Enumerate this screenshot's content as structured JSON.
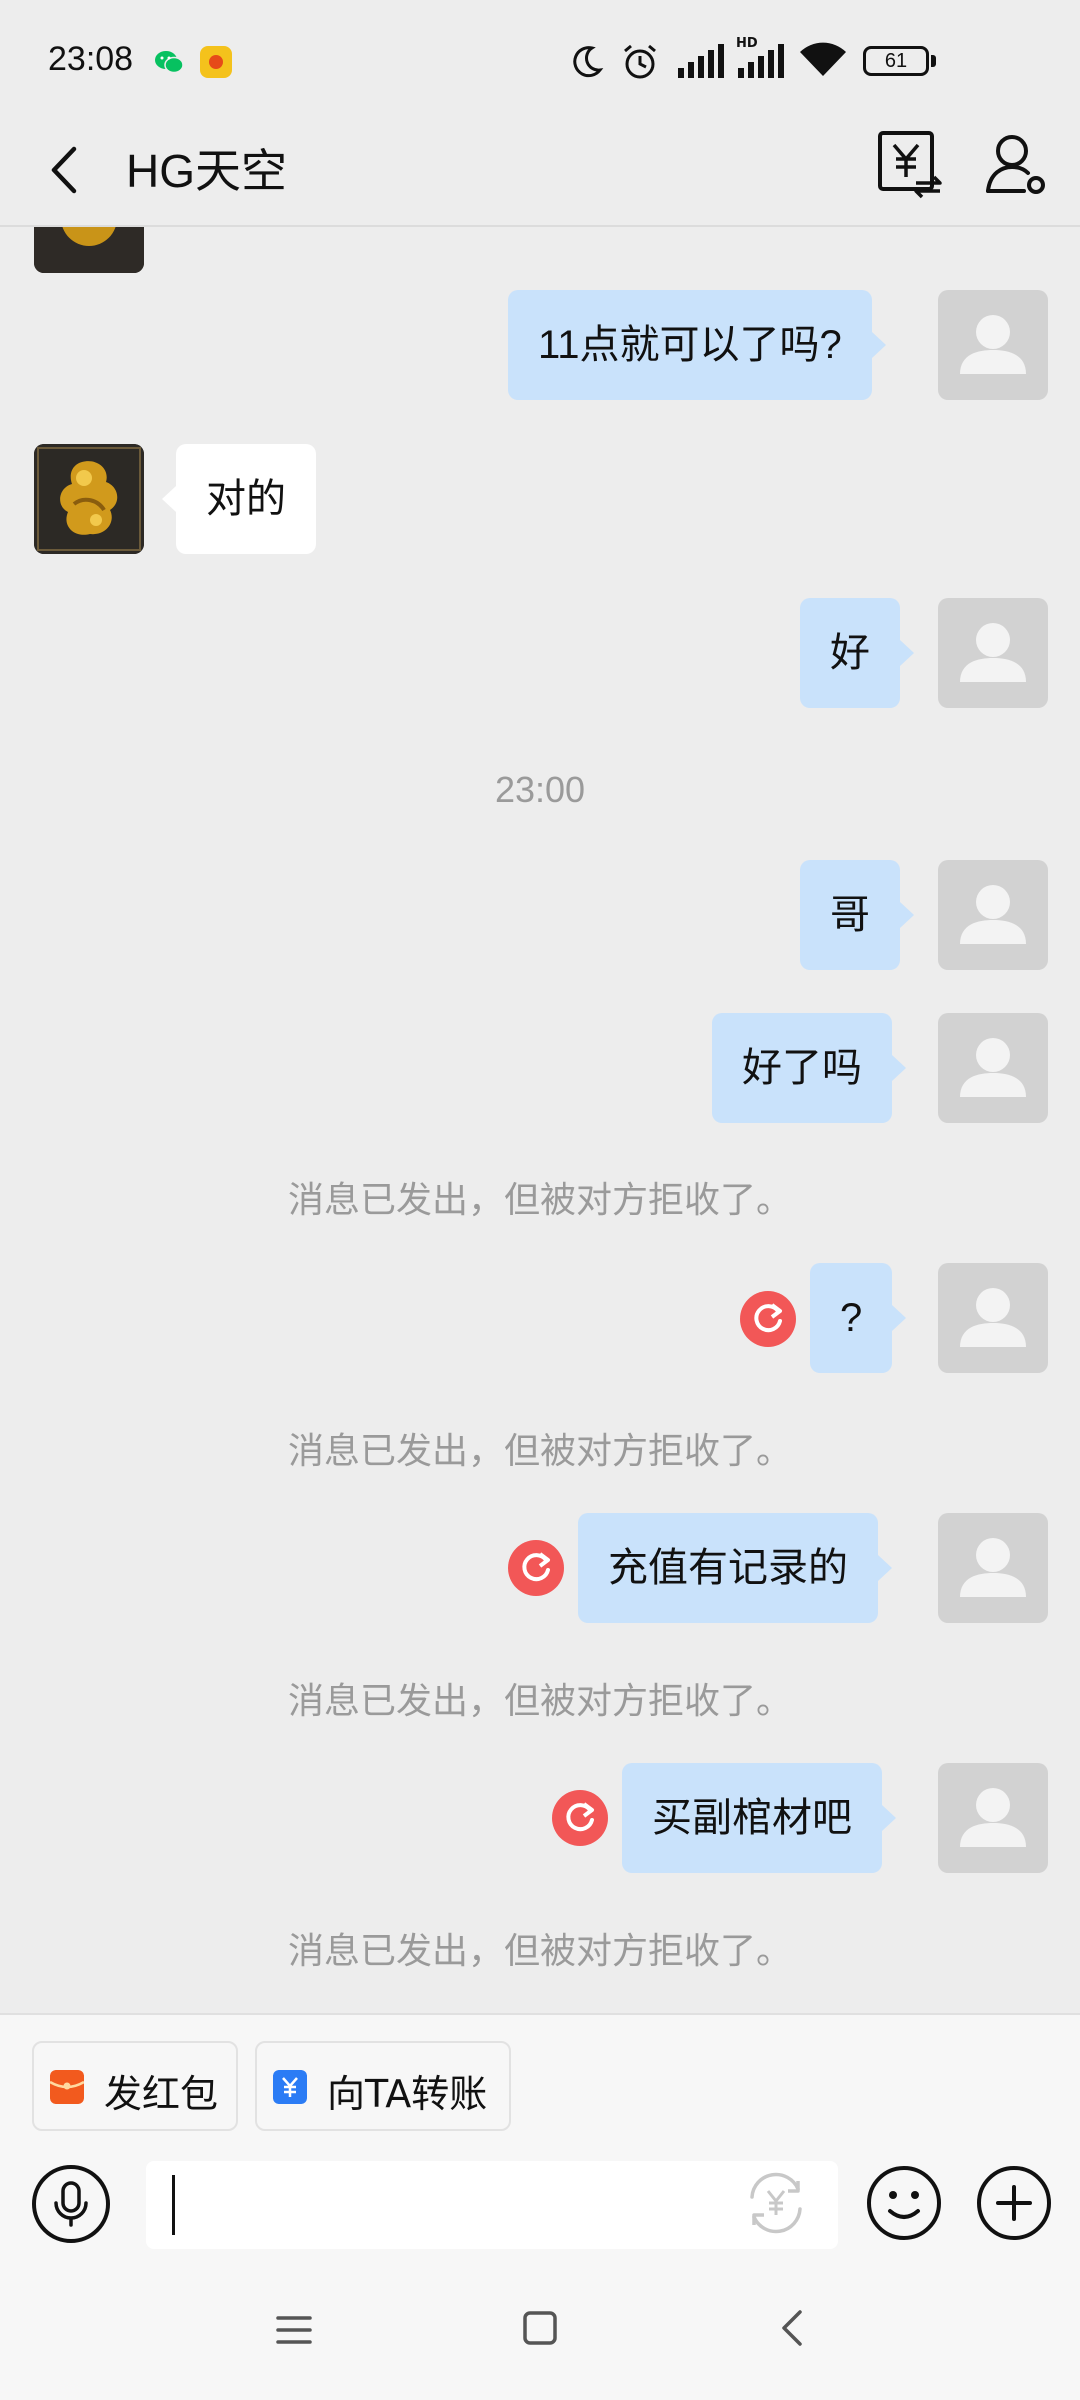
{
  "status_bar": {
    "time": "23:08",
    "hd_label": "HD",
    "battery": "61",
    "icons": [
      "wechat-icon",
      "app-notification-icon",
      "moon-icon",
      "alarm-icon",
      "signal-icon",
      "signal-hd-icon",
      "wifi-icon",
      "battery-icon"
    ]
  },
  "header": {
    "title": "HG天空",
    "icons": [
      "back-icon",
      "transfer-icon",
      "profile-icon"
    ]
  },
  "messages": [
    {
      "from": "me",
      "text": "11点就可以了吗?"
    },
    {
      "from": "them",
      "text": "对的"
    },
    {
      "from": "me",
      "text": "好"
    },
    {
      "type": "time",
      "text": "23:00"
    },
    {
      "from": "me",
      "text": "哥"
    },
    {
      "from": "me",
      "text": "好了吗"
    },
    {
      "type": "system",
      "text": "消息已发出，但被对方拒收了。"
    },
    {
      "from": "me",
      "text": "?",
      "failed": true
    },
    {
      "type": "system",
      "text": "消息已发出，但被对方拒收了。"
    },
    {
      "from": "me",
      "text": "充值有记录的",
      "failed": true
    },
    {
      "type": "system",
      "text": "消息已发出，但被对方拒收了。"
    },
    {
      "from": "me",
      "text": "买副棺材吧",
      "failed": true
    },
    {
      "type": "system",
      "text": "消息已发出，但被对方拒收了。"
    }
  ],
  "quick_actions": [
    {
      "label": "发红包",
      "icon": "red-packet-icon",
      "color": "#f25a1e"
    },
    {
      "label": "向TA转账",
      "icon": "transfer-icon",
      "color": "#2b7cf5"
    }
  ],
  "input": {
    "value": "",
    "placeholder": ""
  },
  "colors": {
    "background": "#ededed",
    "my_bubble": "#c9e2fb",
    "their_bubble": "#ffffff",
    "failed_badge": "#f25757"
  },
  "navbar": {
    "icons": [
      "menu-icon",
      "home-icon",
      "back-nav-icon"
    ]
  }
}
